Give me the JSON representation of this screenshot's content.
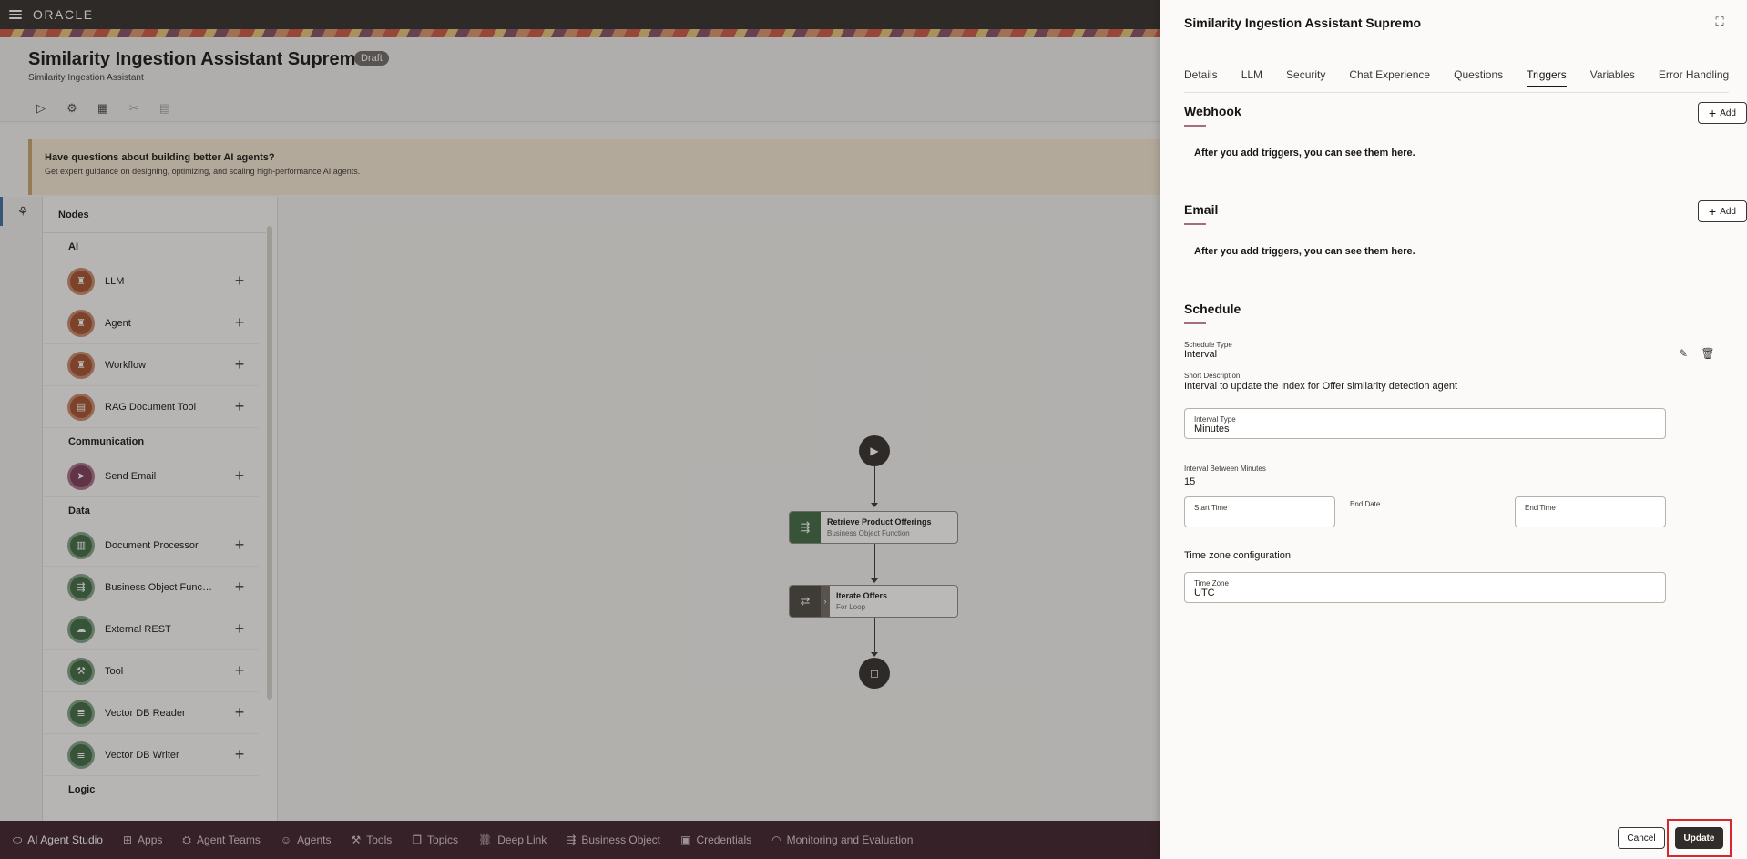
{
  "app": {
    "logo": "ORACLE",
    "title": "Similarity Ingestion Assistant Supremo",
    "badge": "Draft",
    "subtitle": "Similarity Ingestion Assistant",
    "help": {
      "title": "Have questions about building better AI agents?",
      "subtitle": "Get expert guidance on designing, optimizing, and scaling high-performance AI agents."
    }
  },
  "nodes_panel": {
    "header": "Nodes",
    "categories": [
      {
        "name": "AI",
        "items": [
          "LLM",
          "Agent",
          "Workflow",
          "RAG Document Tool"
        ]
      },
      {
        "name": "Communication",
        "items": [
          "Send Email"
        ]
      },
      {
        "name": "Data",
        "items": [
          "Document Processor",
          "Business Object Function",
          "External REST",
          "Tool",
          "Vector DB Reader",
          "Vector DB Writer"
        ]
      },
      {
        "name": "Logic",
        "items": []
      }
    ]
  },
  "canvas": {
    "nodes": [
      {
        "title": "Retrieve Product Offerings",
        "subtitle": "Business Object Function"
      },
      {
        "title": "Iterate Offers",
        "subtitle": "For Loop"
      }
    ]
  },
  "bottom_nav": [
    "AI Agent Studio",
    "Apps",
    "Agent Teams",
    "Agents",
    "Tools",
    "Topics",
    "Deep Link",
    "Business Object",
    "Credentials",
    "Monitoring and Evaluation"
  ],
  "drawer": {
    "title": "Similarity Ingestion Assistant Supremo",
    "tabs": [
      "Details",
      "LLM",
      "Security",
      "Chat Experience",
      "Questions",
      "Triggers",
      "Variables",
      "Error Handling"
    ],
    "active_tab": "Triggers",
    "webhook": {
      "heading": "Webhook",
      "add": "Add",
      "empty": "After you add triggers, you can see them here."
    },
    "email": {
      "heading": "Email",
      "add": "Add",
      "empty": "After you add triggers, you can see them here."
    },
    "schedule": {
      "heading": "Schedule",
      "schedule_type_label": "Schedule Type",
      "schedule_type": "Interval",
      "short_desc_label": "Short Description",
      "short_desc": "Interval to update the index for Offer similarity detection agent",
      "interval_type_label": "Interval Type",
      "interval_type": "Minutes",
      "interval_between_label": "Interval Between Minutes",
      "interval_between": "15",
      "start_time_label": "Start Time",
      "end_date_label": "End Date",
      "end_time_label": "End Time",
      "tz_heading": "Time zone configuration",
      "tz_label": "Time Zone",
      "tz_value": "UTC"
    },
    "footer": {
      "cancel": "Cancel",
      "update": "Update"
    }
  }
}
